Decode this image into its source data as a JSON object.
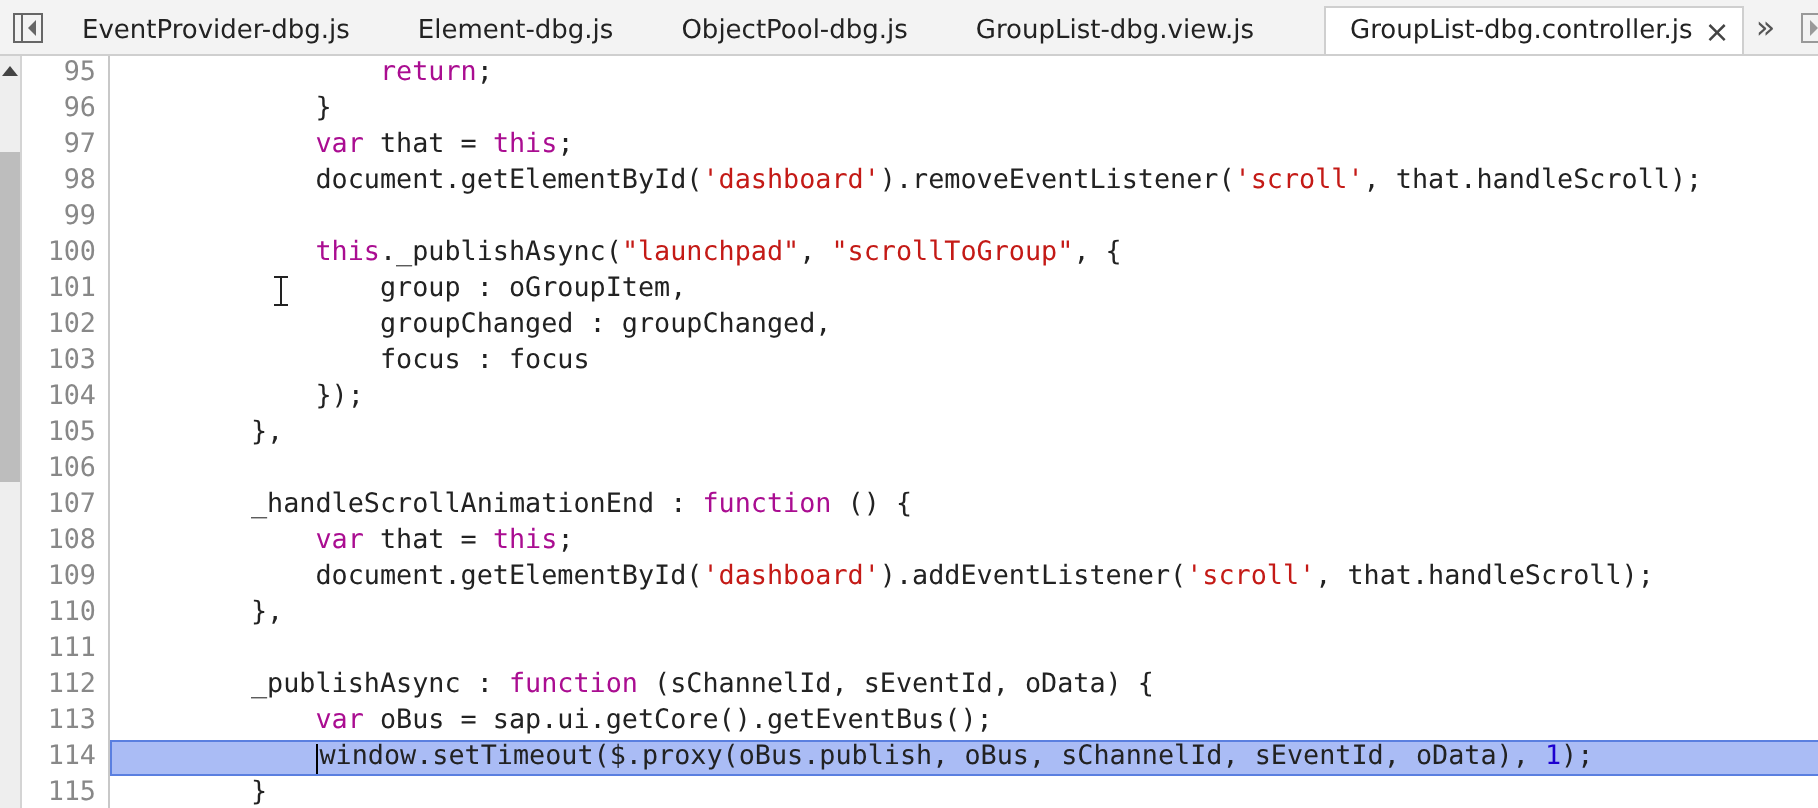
{
  "tabs": [
    {
      "label": "EventProvider-dbg.js",
      "selected": false
    },
    {
      "label": "Element-dbg.js",
      "selected": false
    },
    {
      "label": "ObjectPool-dbg.js",
      "selected": false
    },
    {
      "label": "GroupList-dbg.view.js",
      "selected": false
    },
    {
      "label": "GroupList-dbg.controller.js",
      "selected": true
    }
  ],
  "close_glyph": "×",
  "overflow_glyph": "»",
  "editor": {
    "lines": [
      {
        "number": "95",
        "selected": false,
        "tokens": [
          {
            "kind": "keyword",
            "text": "                return"
          },
          {
            "kind": "plain",
            "text": ";"
          }
        ]
      },
      {
        "number": "96",
        "selected": false,
        "tokens": [
          {
            "kind": "plain",
            "text": "            }"
          }
        ]
      },
      {
        "number": "97",
        "selected": false,
        "tokens": [
          {
            "kind": "keyword",
            "text": "            var"
          },
          {
            "kind": "plain",
            "text": " that = "
          },
          {
            "kind": "keyword",
            "text": "this"
          },
          {
            "kind": "plain",
            "text": ";"
          }
        ]
      },
      {
        "number": "98",
        "selected": false,
        "tokens": [
          {
            "kind": "plain",
            "text": "            document.getElementById("
          },
          {
            "kind": "string",
            "text": "'dashboard'"
          },
          {
            "kind": "plain",
            "text": ").removeEventListener("
          },
          {
            "kind": "string",
            "text": "'scroll'"
          },
          {
            "kind": "plain",
            "text": ", that.handleScroll);"
          }
        ]
      },
      {
        "number": "99",
        "selected": false
      },
      {
        "number": "100",
        "selected": false,
        "tokens": [
          {
            "kind": "keyword",
            "text": "            this"
          },
          {
            "kind": "plain",
            "text": "._publishAsync("
          },
          {
            "kind": "string",
            "text": "\"launchpad\""
          },
          {
            "kind": "plain",
            "text": ", "
          },
          {
            "kind": "string",
            "text": "\"scrollToGroup\""
          },
          {
            "kind": "plain",
            "text": ", {"
          }
        ]
      },
      {
        "number": "101",
        "selected": false,
        "tokens": [
          {
            "kind": "plain",
            "text": "                group : oGroupItem,"
          }
        ]
      },
      {
        "number": "102",
        "selected": false,
        "tokens": [
          {
            "kind": "plain",
            "text": "                groupChanged : groupChanged,"
          }
        ]
      },
      {
        "number": "103",
        "selected": false,
        "tokens": [
          {
            "kind": "plain",
            "text": "                focus : focus"
          }
        ]
      },
      {
        "number": "104",
        "selected": false,
        "tokens": [
          {
            "kind": "plain",
            "text": "            });"
          }
        ]
      },
      {
        "number": "105",
        "selected": false,
        "tokens": [
          {
            "kind": "plain",
            "text": "        },"
          }
        ]
      },
      {
        "number": "106",
        "selected": false
      },
      {
        "number": "107",
        "selected": false,
        "tokens": [
          {
            "kind": "plain",
            "text": "        _handleScrollAnimationEnd : "
          },
          {
            "kind": "keyword",
            "text": "function"
          },
          {
            "kind": "plain",
            "text": " () {"
          }
        ]
      },
      {
        "number": "108",
        "selected": false,
        "tokens": [
          {
            "kind": "keyword",
            "text": "            var"
          },
          {
            "kind": "plain",
            "text": " that = "
          },
          {
            "kind": "keyword",
            "text": "this"
          },
          {
            "kind": "plain",
            "text": ";"
          }
        ]
      },
      {
        "number": "109",
        "selected": false,
        "tokens": [
          {
            "kind": "plain",
            "text": "            document.getElementById("
          },
          {
            "kind": "string",
            "text": "'dashboard'"
          },
          {
            "kind": "plain",
            "text": ").addEventListener("
          },
          {
            "kind": "string",
            "text": "'scroll'"
          },
          {
            "kind": "plain",
            "text": ", that.handleScroll);"
          }
        ]
      },
      {
        "number": "110",
        "selected": false,
        "tokens": [
          {
            "kind": "plain",
            "text": "        },"
          }
        ]
      },
      {
        "number": "111",
        "selected": false
      },
      {
        "number": "112",
        "selected": false,
        "tokens": [
          {
            "kind": "plain",
            "text": "        _publishAsync : "
          },
          {
            "kind": "keyword",
            "text": "function"
          },
          {
            "kind": "plain",
            "text": " (sChannelId, sEventId, oData) {"
          }
        ]
      },
      {
        "number": "113",
        "selected": false,
        "tokens": [
          {
            "kind": "keyword",
            "text": "            var"
          },
          {
            "kind": "plain",
            "text": " oBus = sap.ui.getCore().getEventBus();"
          }
        ]
      },
      {
        "number": "114",
        "selected": true,
        "tokens": [
          {
            "kind": "plain",
            "text": "            window.setTimeout($.proxy(oBus.publish, oBus, sChannelId, sEventId, oData), "
          },
          {
            "kind": "number",
            "text": "1"
          },
          {
            "kind": "plain",
            "text": ");"
          }
        ]
      },
      {
        "number": "115",
        "selected": false,
        "tokens": [
          {
            "kind": "plain",
            "text": "        }"
          }
        ]
      }
    ]
  }
}
